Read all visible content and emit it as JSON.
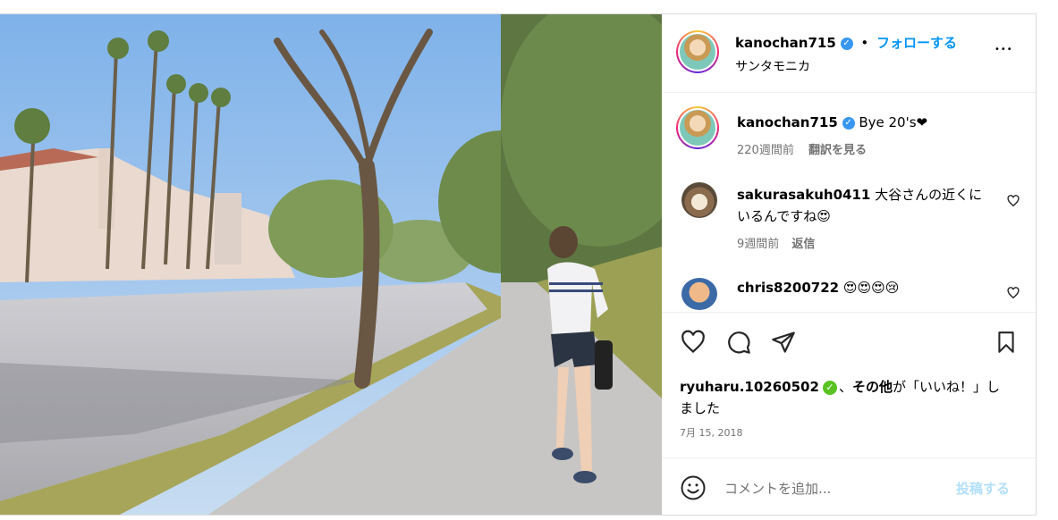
{
  "header": {
    "username": "kanochan715",
    "dot": "•",
    "follow_label": "フォローする",
    "location": "サンタモニカ",
    "more_label": "•••"
  },
  "caption": {
    "username": "kanochan715",
    "text": "Bye 20's❤",
    "age": "220週間前",
    "translate_label": "翻訳を見る"
  },
  "comments": [
    {
      "username": "sakurasakuh0411",
      "text_line1": "大谷さんの近くに",
      "text_line2": "いるんですね😍",
      "age": "9週間前",
      "reply_label": "返信"
    },
    {
      "username": "chris8200722",
      "text_line1": "😍😍😍😢"
    }
  ],
  "likes": {
    "username": "ryuharu.10260502",
    "sep": "、",
    "others": "その他",
    "rest_line1": "が「いいね！」し",
    "rest_line2": "ました"
  },
  "date": "7月 15, 2018",
  "composer": {
    "placeholder": "コメントを追加...",
    "post_label": "投稿する"
  },
  "colors": {
    "link": "#0095f6",
    "post_disabled": "#b2dffc",
    "verified": "#3897f0",
    "border": "#dbdbdb"
  }
}
